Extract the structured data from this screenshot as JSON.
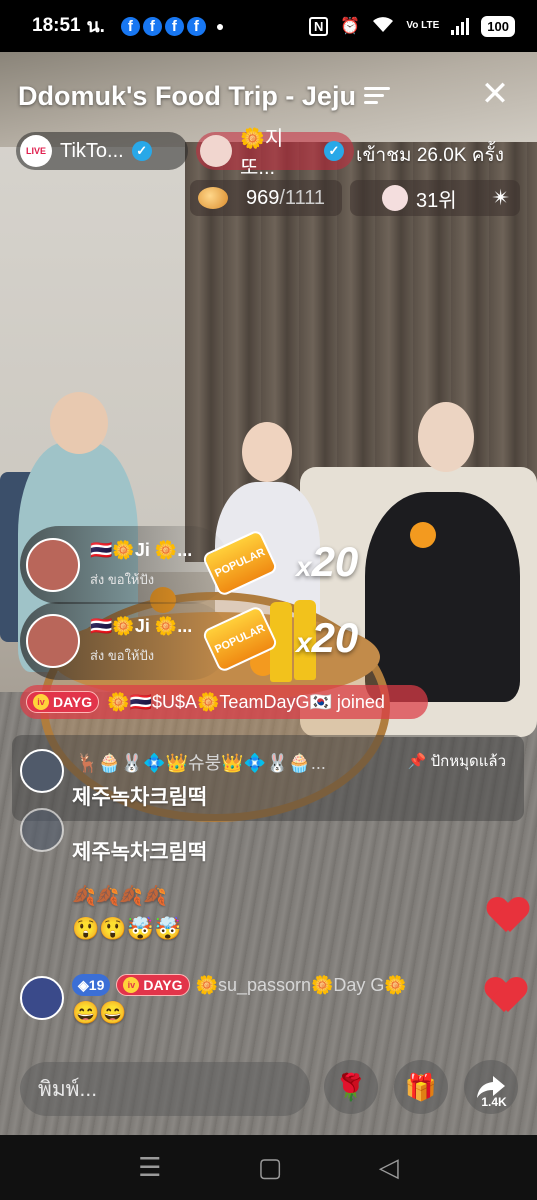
{
  "status_bar": {
    "time": "18:51",
    "suffix": "น.",
    "notification_icons": [
      "facebook-icon",
      "facebook-icon",
      "facebook-icon",
      "facebook-icon"
    ],
    "fb_glyph": "f",
    "nfc": "N",
    "volte": "Vo LTE",
    "battery": "100"
  },
  "live": {
    "title": "Ddomuk's Food Trip - Jeju",
    "platform_chip": "TikTo...",
    "platform_badge": "LIVE",
    "host_chip": "🌼지또...",
    "viewers": "เข้าชม 26.0K ครั้ง",
    "rank_current": "969",
    "rank_total": "/1111",
    "ranking": "31위"
  },
  "gifts": [
    {
      "name": "🇹🇭🌼Ji 🌼...",
      "sub": "ส่ง ขอให้ปัง",
      "badge": "POPULAR",
      "multiplier": "x",
      "count": "20"
    },
    {
      "name": "🇹🇭🌼Ji 🌼...",
      "sub": "ส่ง ขอให้ปัง",
      "badge": "POPULAR",
      "multiplier": "x",
      "count": "20"
    }
  ],
  "joined": {
    "tag": "DAYG",
    "text": "🌼🇹🇭$U$A🌼TeamDayG🇰🇷 joined"
  },
  "chat": {
    "pinned": {
      "name": "🦌🧁🐰💠👑슈붕👑💠🐰🧁...",
      "message": "제주녹차크림떡",
      "pin_label": "ปักหมุดแล้ว"
    },
    "messages": [
      {
        "message": "제주녹차크림떡"
      },
      {
        "message": "🍂🍂🍂🍂"
      },
      {
        "message": "😲😲🤯🤯"
      },
      {
        "level": "19",
        "tag": "DAYG",
        "name": "🌼su_passorn🌼Day G🌼",
        "message": "😄😄"
      }
    ]
  },
  "bottom": {
    "input_placeholder": "พิมพ์...",
    "share_count": "1.4K"
  },
  "colors": {
    "accent_red": "#e2344a",
    "verified_blue": "#29a8e8",
    "heart_red": "#e8323c",
    "facebook_blue": "#1877f2"
  }
}
